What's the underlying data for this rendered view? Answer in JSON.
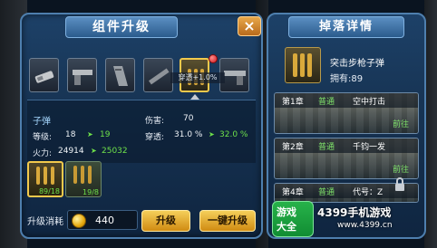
{
  "upgrade_panel": {
    "title": "组件升级",
    "close_label": "×",
    "parts": [
      {
        "name": "muzzle-part"
      },
      {
        "name": "pistol-part"
      },
      {
        "name": "magazine-part"
      },
      {
        "name": "barrel-part"
      },
      {
        "name": "ammo-part"
      },
      {
        "name": "grip-part"
      }
    ],
    "selected_percent": "穿透+1.0%",
    "item_name": "子弹",
    "level_label": "等级:",
    "level_current": "18",
    "level_next": "19",
    "firepower_label": "火力:",
    "firepower_current": "24914",
    "firepower_next": "25032",
    "damage_label": "伤害:",
    "damage_value": "70",
    "pierce_label": "穿透:",
    "pierce_current": "31.0 %",
    "pierce_next": "32.0 %",
    "ammo_slots": [
      {
        "count": "89/18"
      },
      {
        "count": "19/8"
      }
    ],
    "cost_label": "升级消耗",
    "cost_amount": "440",
    "upgrade_button": "升级",
    "one_click_button": "一键升级"
  },
  "drop_panel": {
    "title": "掉落详情",
    "item_name": "突击步枪子弹",
    "owned": "拥有:89",
    "chapters": [
      {
        "chapter": "第1章",
        "mode": "普通",
        "name": "空中打击",
        "go": "前往"
      },
      {
        "chapter": "第2章",
        "mode": "普通",
        "name": "千钧一发",
        "go": "前往"
      },
      {
        "chapter": "第4章",
        "mode": "普通",
        "name": "代号：Z",
        "go": ""
      }
    ]
  },
  "watermark": {
    "logo_line1": "游戏",
    "logo_line2": "大全",
    "site_title": "4399手机游戏",
    "site_url": "www.4399.cn"
  }
}
